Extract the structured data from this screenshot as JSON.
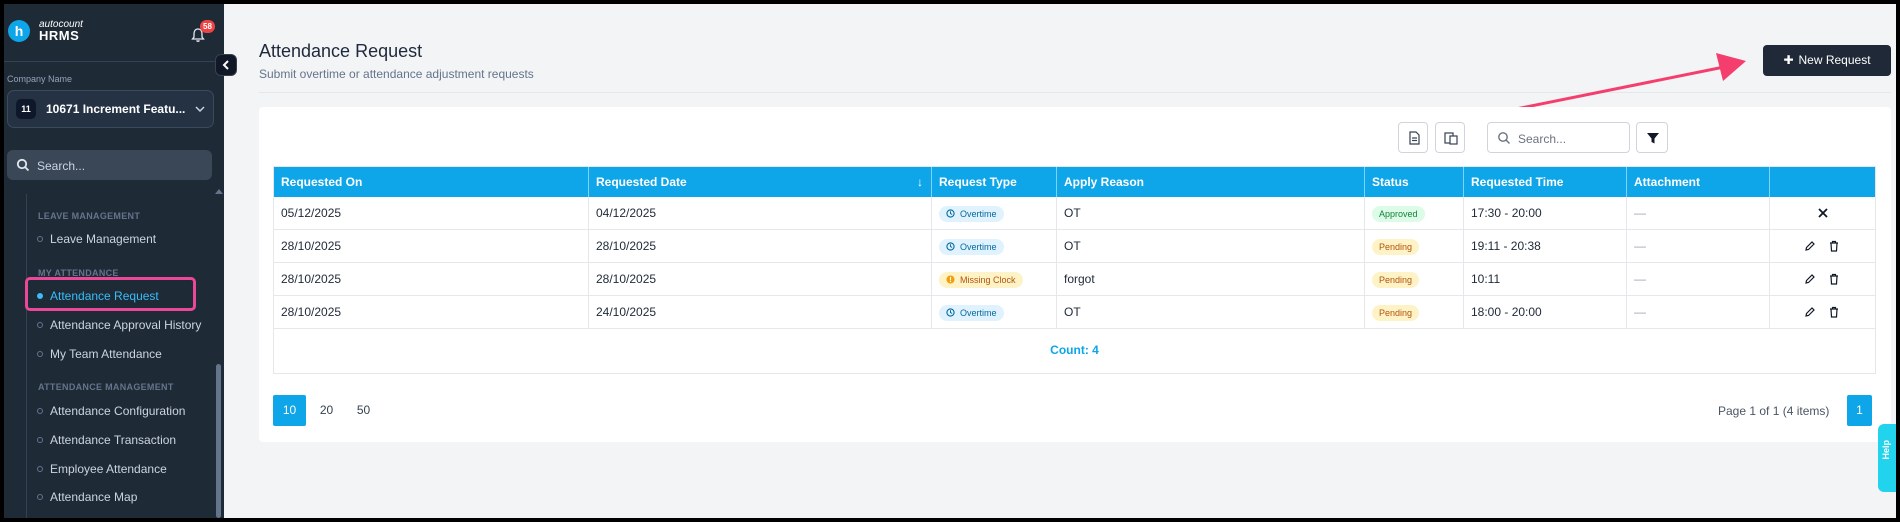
{
  "app": {
    "brand_line1": "autocount",
    "brand_line2": "HRMS",
    "logo_letter": "h",
    "notification_count": "58",
    "accent_color": "#0ea5e9",
    "collapse_icon": "chevron-left-icon"
  },
  "sidebar": {
    "company_label": "Company Name",
    "company_avatar": "11",
    "company_name": "10671 Increment Featu...",
    "search_placeholder": "Search...",
    "sections": [
      {
        "title": "LEAVE MANAGEMENT",
        "items": [
          "Leave Management"
        ]
      },
      {
        "title": "MY ATTENDANCE",
        "items": [
          "Attendance Request",
          "Attendance Approval History",
          "My Team Attendance"
        ]
      },
      {
        "title": "ATTENDANCE MANAGEMENT",
        "items": [
          "Attendance Configuration",
          "Attendance Transaction",
          "Employee Attendance",
          "Attendance Map"
        ]
      }
    ],
    "active_item": "Attendance Request"
  },
  "page": {
    "title": "Attendance Request",
    "subtitle": "Submit overtime or attendance adjustment requests",
    "new_button": "New Request"
  },
  "toolbar": {
    "search_placeholder": "Search..."
  },
  "table": {
    "columns": [
      "Requested On",
      "Requested Date",
      "Request Type",
      "Apply Reason",
      "Status",
      "Requested Time",
      "Attachment",
      ""
    ],
    "rows": [
      {
        "requested_on": "05/12/2025",
        "requested_date": "04/12/2025",
        "type": "Overtime",
        "reason": "OT",
        "status": "Approved",
        "time": "17:30 - 20:00",
        "attachment": "—"
      },
      {
        "requested_on": "28/10/2025",
        "requested_date": "28/10/2025",
        "type": "Overtime",
        "reason": "OT",
        "status": "Pending",
        "time": "19:11 - 20:38",
        "attachment": "—"
      },
      {
        "requested_on": "28/10/2025",
        "requested_date": "28/10/2025",
        "type": "Missing Clock",
        "reason": "forgot",
        "status": "Pending",
        "time": "10:11",
        "attachment": "—"
      },
      {
        "requested_on": "28/10/2025",
        "requested_date": "24/10/2025",
        "type": "Overtime",
        "reason": "OT",
        "status": "Pending",
        "time": "18:00 - 20:00",
        "attachment": "—"
      }
    ],
    "count_text": "Count: 4"
  },
  "pager": {
    "sizes": [
      "10",
      "20",
      "50"
    ],
    "selected_size": "10",
    "info": "Page 1 of 1 (4 items)",
    "current_page": "1"
  },
  "help": {
    "label": "Help"
  }
}
